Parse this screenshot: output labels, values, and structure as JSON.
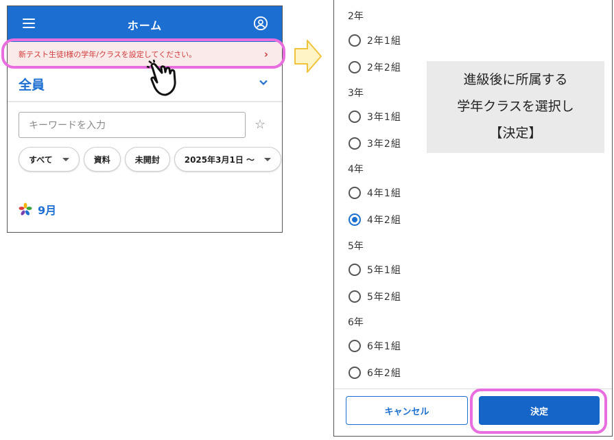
{
  "home": {
    "header_title": "ホーム",
    "notice_text": "新テスト生徒Ⅰ様の学年/クラスを設定してください。",
    "notice_chevron": "›",
    "group_label": "全員",
    "search_placeholder": "キーワードを入力",
    "chips": [
      {
        "label": "すべて",
        "dropdown": true
      },
      {
        "label": "資料",
        "dropdown": false
      },
      {
        "label": "未開封",
        "dropdown": false
      },
      {
        "label": "2025年3月1日 〜",
        "dropdown": true
      }
    ],
    "month_label": "9月"
  },
  "class_select": {
    "grades": [
      {
        "header": "2年",
        "options": [
          {
            "label": "2年1組",
            "checked": false
          },
          {
            "label": "2年2組",
            "checked": false
          }
        ]
      },
      {
        "header": "3年",
        "options": [
          {
            "label": "3年1組",
            "checked": false
          },
          {
            "label": "3年2組",
            "checked": false
          }
        ]
      },
      {
        "header": "4年",
        "options": [
          {
            "label": "4年1組",
            "checked": false
          },
          {
            "label": "4年2組",
            "checked": true
          }
        ]
      },
      {
        "header": "5年",
        "options": [
          {
            "label": "5年1組",
            "checked": false
          },
          {
            "label": "5年2組",
            "checked": false
          }
        ]
      },
      {
        "header": "6年",
        "options": [
          {
            "label": "6年1組",
            "checked": false
          },
          {
            "label": "6年2組",
            "checked": false
          }
        ]
      }
    ],
    "cancel_label": "キャンセル",
    "decide_label": "決定"
  },
  "callout": {
    "lines": [
      "進級後に所属する",
      "学年クラスを選択し",
      "【決定】"
    ]
  },
  "colors": {
    "accent": "#1c6fd1",
    "notice_bg": "#fbeaea",
    "notice_text": "#d23a3a",
    "highlight": "#e86ee0",
    "arrow_fill": "#fff4c6",
    "arrow_stroke": "#f2c23a"
  },
  "icons": [
    "menu-icon",
    "account-icon",
    "chevron-right-icon",
    "chevron-down-icon",
    "star-icon",
    "flower-logo-icon",
    "pointing-hand-icon",
    "right-arrow-icon",
    "radio-button"
  ]
}
